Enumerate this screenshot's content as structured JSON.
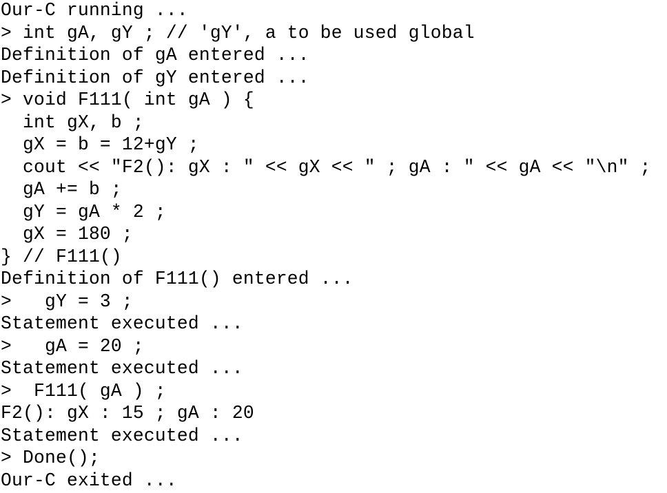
{
  "console": {
    "lines": [
      "Our-C running ...",
      "> int gA, gY ; // 'gY', a to be used global",
      "Definition of gA entered ...",
      "Definition of gY entered ...",
      "> void F111( int gA ) {",
      "  int gX, b ;",
      "  gX = b = 12+gY ;",
      "  cout << \"F2(): gX : \" << gX << \" ; gA : \" << gA << \"\\n\" ;",
      "  gA += b ;",
      "  gY = gA * 2 ;",
      "  gX = 180 ;",
      "} // F111()",
      "Definition of F111() entered ...",
      ">   gY = 3 ;",
      "Statement executed ...",
      ">   gA = 20 ;",
      "Statement executed ...",
      ">  F111( gA ) ;",
      "F2(): gX : 15 ; gA : 20",
      "Statement executed ...",
      "> Done();",
      "Our-C exited ..."
    ]
  }
}
